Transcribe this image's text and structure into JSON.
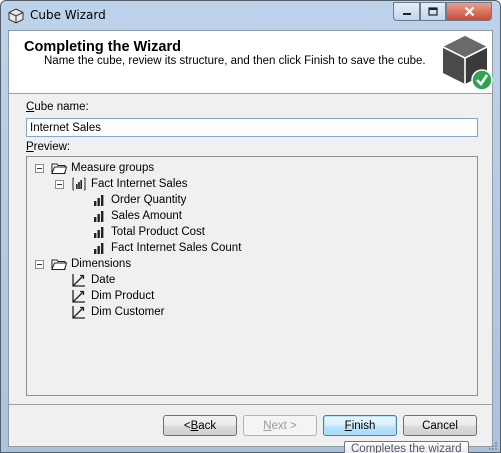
{
  "window": {
    "title": "Cube Wizard",
    "controls": {
      "minimize": "minimize-icon",
      "maximize": "maximize-icon",
      "close": "close-icon"
    }
  },
  "header": {
    "title": "Completing the Wizard",
    "subtitle": "Name the cube, review its structure, and then click Finish to save the cube.",
    "icon": "cube-check-icon"
  },
  "cube_name": {
    "label_prefix": "",
    "label_key": "C",
    "label_rest": "ube name:",
    "value": "Internet Sales"
  },
  "preview": {
    "label_key": "P",
    "label_rest": "review:",
    "tree": {
      "measure_groups": "Measure groups",
      "fact": "Fact Internet Sales",
      "measures": [
        "Order Quantity",
        "Sales Amount",
        "Total Product Cost",
        "Fact Internet Sales Count"
      ],
      "dimensions_label": "Dimensions",
      "dimensions": [
        "Date",
        "Dim Product",
        "Dim Customer"
      ]
    }
  },
  "buttons": {
    "back": {
      "prefix": "< ",
      "key": "B",
      "rest": "ack"
    },
    "next": {
      "key": "N",
      "rest": "ext >"
    },
    "finish": {
      "key": "F",
      "rest": "inish"
    },
    "cancel": "Cancel"
  },
  "tooltip": "Completes the wizard",
  "colors": {
    "accent": "#3c7fb1",
    "success": "#2da44e",
    "cube": "#4a4a4a"
  }
}
